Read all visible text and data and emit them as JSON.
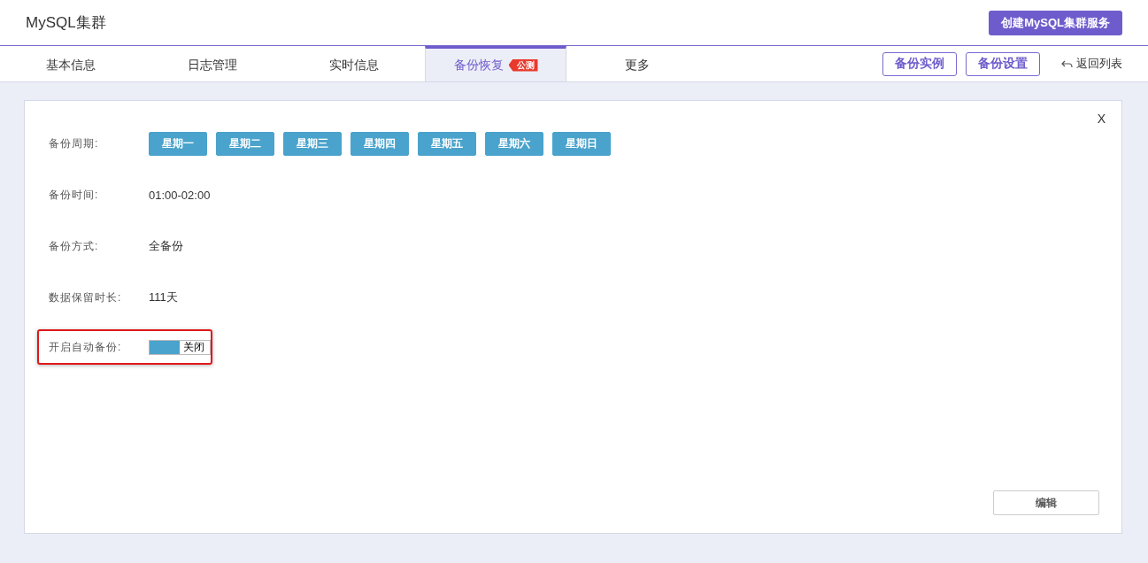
{
  "header": {
    "title": "MySQL集群",
    "create_button": "创建MySQL集群服务"
  },
  "tabs": [
    {
      "label": "基本信息",
      "selected": false
    },
    {
      "label": "日志管理",
      "selected": false
    },
    {
      "label": "实时信息",
      "selected": false
    },
    {
      "label": "备份恢复",
      "selected": true,
      "badge": "公测"
    },
    {
      "label": "更多",
      "selected": false
    }
  ],
  "actions": {
    "buttons": [
      "备份实例",
      "备份设置"
    ],
    "back_link": "返回列表"
  },
  "panel": {
    "close": "X",
    "rows": [
      {
        "kind": "days",
        "label": "备份周期:",
        "days": [
          {
            "label": "星期一",
            "selected": true
          },
          {
            "label": "星期二",
            "selected": true
          },
          {
            "label": "星期三",
            "selected": true
          },
          {
            "label": "星期四",
            "selected": true
          },
          {
            "label": "星期五",
            "selected": true
          },
          {
            "label": "星期六",
            "selected": true
          },
          {
            "label": "星期日",
            "selected": true
          }
        ]
      },
      {
        "kind": "text",
        "label": "备份时间:",
        "value": "01:00-02:00"
      },
      {
        "kind": "text",
        "label": "备份方式:",
        "value": "全备份"
      },
      {
        "kind": "text",
        "label": "数据保留时长:",
        "value": "111天"
      },
      {
        "kind": "toggle",
        "label": "开启自动备份:",
        "on": false,
        "toggle_label": "关闭",
        "highlighted": true
      }
    ],
    "edit_button": "编辑"
  }
}
